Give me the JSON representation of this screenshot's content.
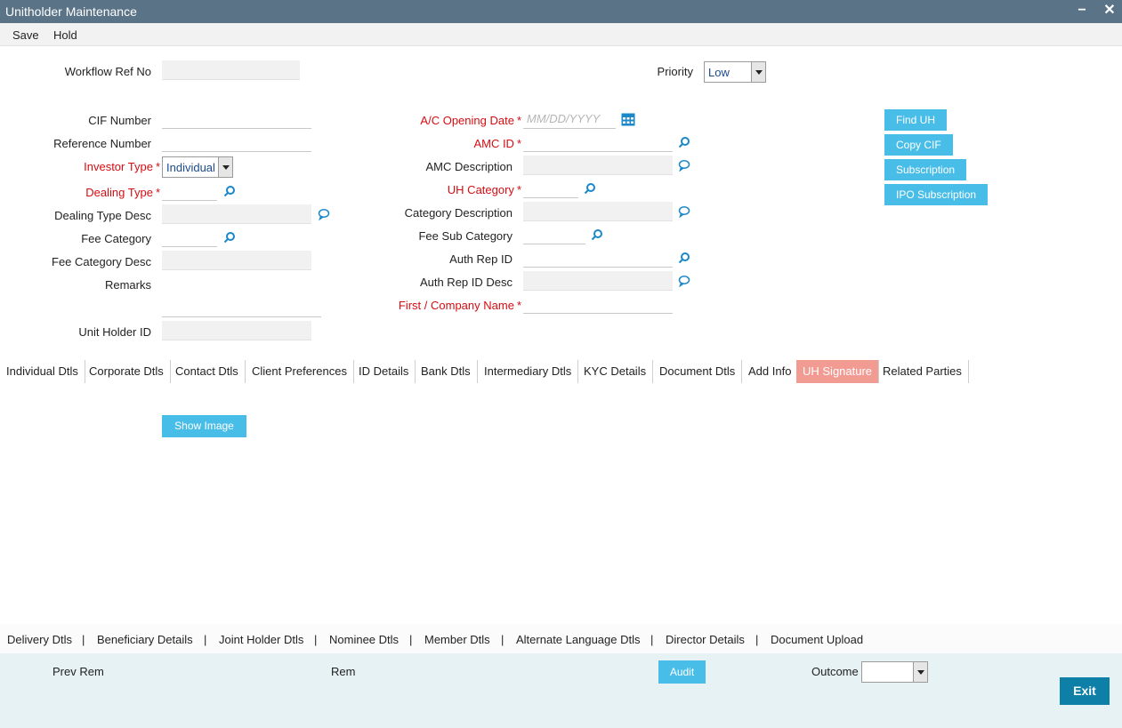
{
  "window": {
    "title": "Unitholder Maintenance",
    "minimize": "−",
    "close": "✕"
  },
  "menu": {
    "save": "Save",
    "hold": "Hold"
  },
  "workflow": {
    "label": "Workflow Ref No",
    "value": ""
  },
  "priority": {
    "label": "Priority",
    "value": "Low"
  },
  "left": {
    "cif_number": "CIF Number",
    "reference_number": "Reference Number",
    "investor_type": "Investor Type",
    "investor_type_value": "Individual",
    "dealing_type": "Dealing Type",
    "dealing_type_desc": "Dealing Type Desc",
    "fee_category": "Fee Category",
    "fee_category_desc": "Fee Category Desc",
    "remarks": "Remarks",
    "unit_holder_id": "Unit Holder ID"
  },
  "mid": {
    "ac_opening_date": "A/C Opening Date",
    "ac_opening_date_placeholder": "MM/DD/YYYY",
    "amc_id": "AMC ID",
    "amc_description": "AMC Description",
    "uh_category": "UH Category",
    "category_description": "Category Description",
    "fee_sub_category": "Fee Sub Category",
    "auth_rep_id": "Auth Rep ID",
    "auth_rep_id_desc": "Auth Rep ID Desc",
    "first_company_name": "First / Company Name"
  },
  "required_mark": "*",
  "side_buttons": [
    "Find UH",
    "Copy CIF",
    "Subscription",
    "IPO Subscription"
  ],
  "tabs": [
    "Individual Dtls",
    "Corporate Dtls",
    "Contact Dtls",
    "Client Preferences",
    "ID Details",
    "Bank Dtls",
    "Intermediary Dtls",
    "KYC Details",
    "Document Dtls",
    "Add Info",
    "UH Signature",
    "Related Parties"
  ],
  "active_tab": "UH Signature",
  "show_image": "Show Image",
  "bottom_links": [
    "Delivery Dtls",
    "|",
    "Beneficiary Details",
    "|",
    "Joint Holder Dtls",
    "|",
    "Nominee Dtls",
    "|",
    "Member Dtls",
    "|",
    "Alternate Language Dtls",
    "|",
    "Director Details",
    "|",
    "Document Upload"
  ],
  "footer": {
    "prev_rem": "Prev Rem",
    "rem": "Rem",
    "audit": "Audit",
    "outcome": "Outcome",
    "outcome_value": "",
    "exit": "Exit"
  },
  "colors": {
    "titlebar": "#5a7386",
    "accent": "#48bde8",
    "required": "#d40d12",
    "active_tab": "#f29b93",
    "exit": "#0e7fa6"
  }
}
